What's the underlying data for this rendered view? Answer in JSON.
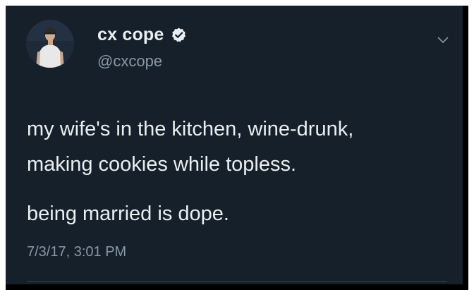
{
  "tweet": {
    "display_name": "cx cope",
    "handle": "@cxcope",
    "verified": true,
    "text_lines": [
      "my wife's in the kitchen, wine-drunk,",
      "making cookies while topless."
    ],
    "text_paragraph_2": "being married is dope.",
    "timestamp": "7/3/17, 3:01 PM"
  },
  "icons": {
    "verified": "verified-badge-icon",
    "more": "chevron-down-icon"
  },
  "colors": {
    "card_background": "#15202b",
    "primary_text": "#e9eef2",
    "secondary_text": "#8899a6",
    "divider": "#38444d",
    "frame": "#ffffff"
  }
}
